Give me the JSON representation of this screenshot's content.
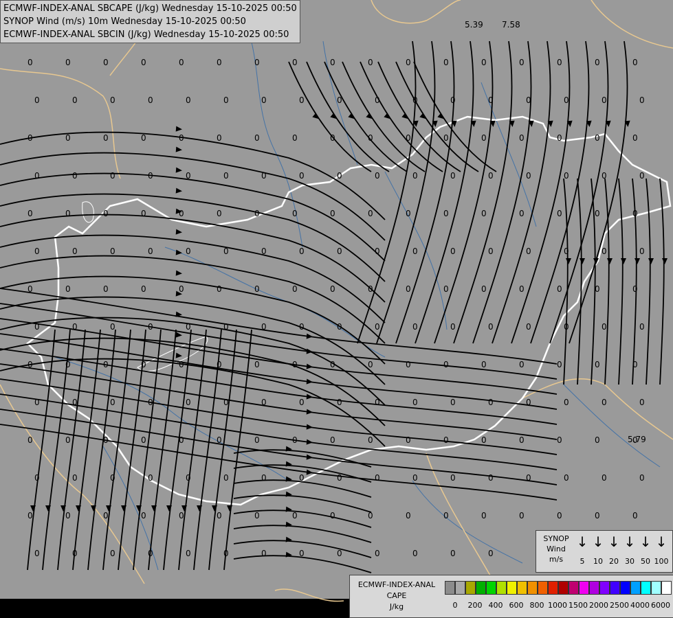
{
  "header": {
    "line1": "ECMWF-INDEX-ANAL SBCAPE (J/kg) Wednesday 15-10-2025 00:50",
    "line2": "SYNOP Wind (m/s) 10m Wednesday 15-10-2025 00:50",
    "line3": "ECMWF-INDEX-ANAL SBCIN (J/kg) Wednesday 15-10-2025 00:50"
  },
  "map_values": {
    "zero": "0",
    "highlighted": [
      "5.39",
      "7.58",
      "5.79"
    ]
  },
  "wind_legend": {
    "title_lines": [
      "SYNOP",
      "Wind",
      "m/s"
    ],
    "speeds": [
      "5",
      "10",
      "20",
      "30",
      "50",
      "100"
    ]
  },
  "cape_legend": {
    "title_lines": [
      "ECMWF-INDEX-ANAL",
      "CAPE",
      "J/kg"
    ],
    "ticks": [
      "0",
      "200",
      "400",
      "600",
      "800",
      "1000",
      "1500",
      "2000",
      "2500",
      "4000",
      "6000"
    ],
    "colors": [
      "#8c8c8c",
      "#a8a8a8",
      "#a8a800",
      "#00b000",
      "#00d400",
      "#b0e000",
      "#f0f000",
      "#f0c000",
      "#f09000",
      "#f06000",
      "#e02000",
      "#b00000",
      "#c00070",
      "#f000f0",
      "#b000e0",
      "#8000ff",
      "#4000ff",
      "#0000ff",
      "#00a0ff",
      "#00ffff",
      "#a0ffff",
      "#ffffff"
    ]
  },
  "colors": {
    "background": "#9a9a9a",
    "country_border": "#ffffff",
    "region_border": "#e8c890",
    "river": "#3a6ea8",
    "streamline": "#000000"
  }
}
